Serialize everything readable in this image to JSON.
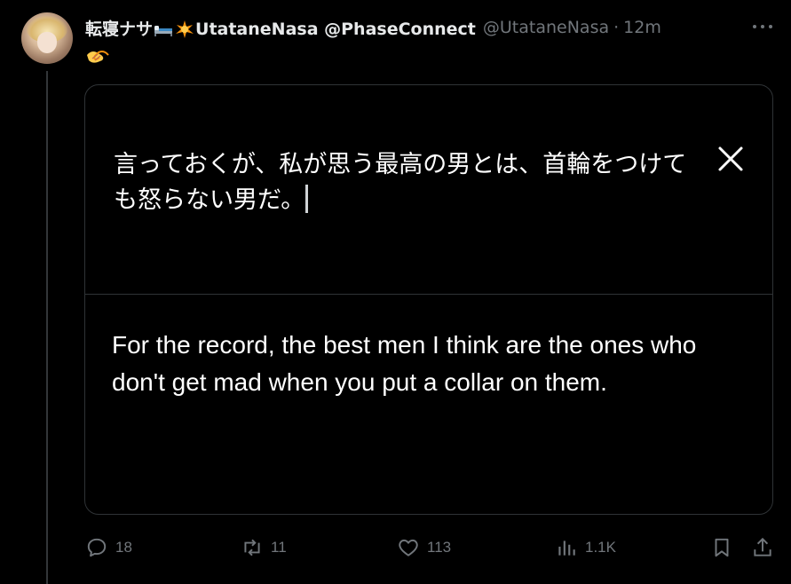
{
  "tweet": {
    "display_name": "転寝ナサ",
    "display_name_suffix": "UtataneNasa @PhaseConnect",
    "name_emojis": [
      "bed-emoji",
      "star-emoji"
    ],
    "handle": "@UtataneNasa",
    "separator": "·",
    "time": "12m",
    "body_emoji": "handshake-emoji"
  },
  "card": {
    "japanese_text": "言っておくが、私が思う最高の男とは、首輪をつけても怒らない男だ。",
    "english_text": "For the record, the best men I think are the ones who don't get mad when you put a collar on them."
  },
  "actions": {
    "replies": "18",
    "retweets": "11",
    "likes": "113",
    "views": "1.1K"
  },
  "colors": {
    "background": "#000000",
    "text_primary": "#e7e9ea",
    "text_secondary": "#71767b",
    "border": "#2f3336"
  }
}
